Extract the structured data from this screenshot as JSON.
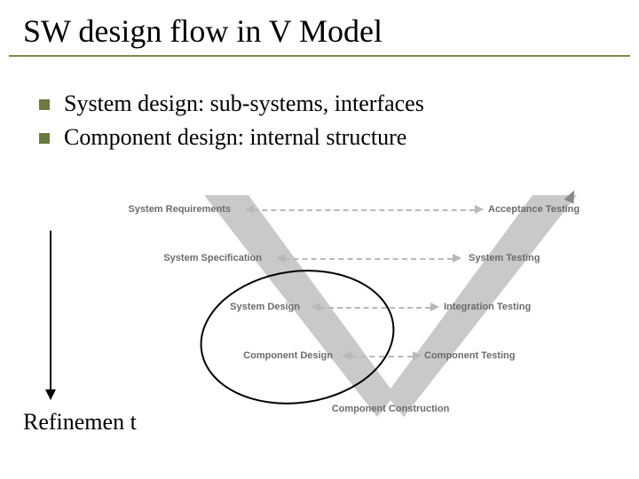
{
  "title": "SW design flow in V Model",
  "bullets": [
    "System design: sub-systems, interfaces",
    "Component design: internal structure"
  ],
  "refinement_label": "Refinemen t",
  "v_model": {
    "left_stages": [
      "System Requirements",
      "System Specification",
      "System Design",
      "Component Design"
    ],
    "bottom_stage": "Component Construction",
    "right_stages": [
      "Acceptance Testing",
      "System Testing",
      "Integration Testing",
      "Component Testing"
    ]
  }
}
